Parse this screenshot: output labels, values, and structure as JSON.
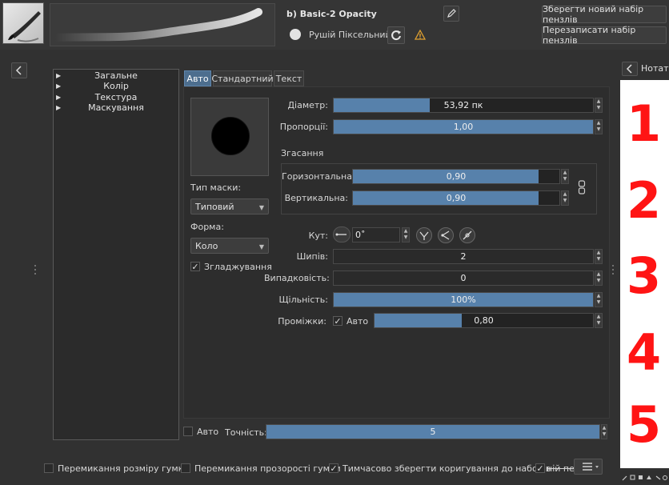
{
  "header": {
    "preset_name": "b) Basic-2 Opacity",
    "engine_name": "Рушій Піксельний",
    "save_new_label": "Зберегти новий набір пензлів",
    "overwrite_label": "Перезаписати набір пензлів"
  },
  "tree": {
    "items": [
      {
        "label": "Загальне"
      },
      {
        "label": "Колір"
      },
      {
        "label": "Текстура"
      },
      {
        "label": "Маскування"
      }
    ]
  },
  "tabs": [
    {
      "label": "Авто",
      "active": true
    },
    {
      "label": "Стандартний",
      "active": false
    },
    {
      "label": "Текст",
      "active": false
    }
  ],
  "mask": {
    "type_label": "Тип маски:",
    "type_value": "Типовий",
    "shape_label": "Форма:",
    "shape_value": "Коло",
    "antialias_label": "Згладжування",
    "antialias_checked": true
  },
  "params": {
    "diameter": {
      "label": "Діаметр:",
      "value": "53,92 пк",
      "fraction": 0.37
    },
    "ratio": {
      "label": "Пропорції:",
      "value": "1,00",
      "fraction": 1.0
    },
    "fade_title": "Згасання",
    "horizontal": {
      "label": "Горизонтальна:",
      "value": "0,90",
      "fraction": 1.0
    },
    "vertical": {
      "label": "Вертикальна:",
      "value": "0,90",
      "fraction": 1.0
    },
    "angle": {
      "label": "Кут:",
      "value": "0˚"
    },
    "spikes": {
      "label": "Шипів:",
      "value": "2"
    },
    "randomness": {
      "label": "Випадковість:",
      "value": "0"
    },
    "density": {
      "label": "Щільність:",
      "value": "100%",
      "fraction": 1.0
    },
    "spacing": {
      "label": "Проміжки:",
      "auto_label": "Авто",
      "auto_checked": true,
      "value": "0,80",
      "fraction": 0.4
    }
  },
  "accuracy": {
    "auto_label": "Авто",
    "auto_checked": false,
    "label": "Точність:",
    "value": "5",
    "fraction": 1.0
  },
  "bottom": {
    "eraser_size_label": "Перемикання розміру гумки",
    "eraser_size_checked": false,
    "eraser_opacity_label": "Перемикання прозорості гумки",
    "eraser_opacity_checked": false,
    "temp_save_label": "Тимчасово зберегти коригування до наборів",
    "temp_save_checked": true,
    "extra_label": "ній пе",
    "extra_checked": true
  },
  "notes": {
    "title": "Нотат",
    "numbers": [
      "1",
      "2",
      "3",
      "4",
      "5"
    ]
  },
  "colors": {
    "accent": "#5781ab",
    "note_ink": "#ff1414"
  }
}
